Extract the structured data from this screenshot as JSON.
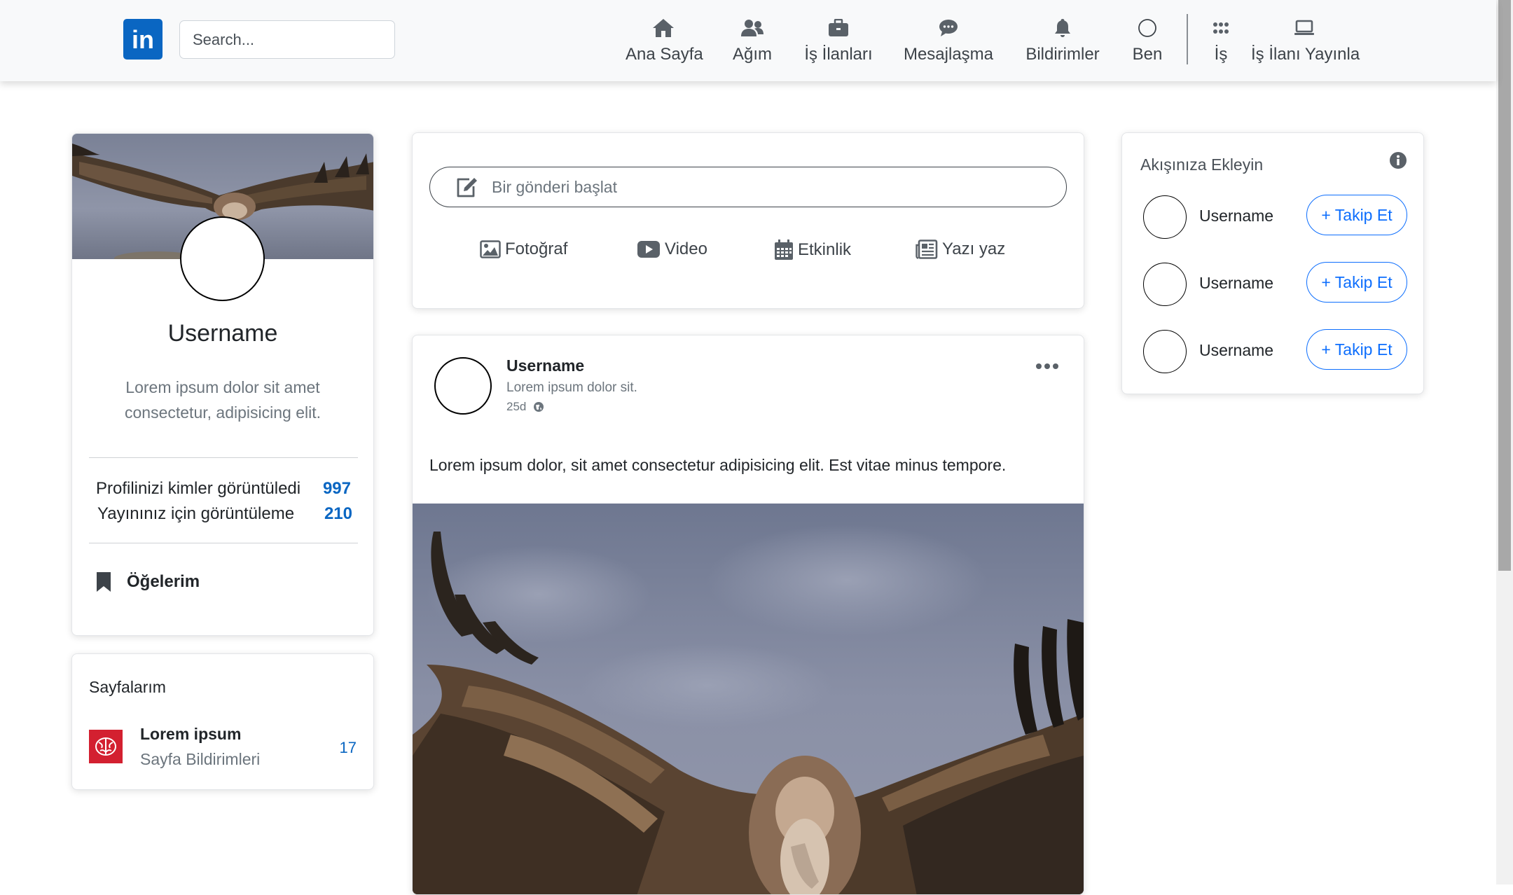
{
  "navbar": {
    "logo_text": "in",
    "search_placeholder": "Search...",
    "items": [
      {
        "label": "Ana Sayfa",
        "icon": "home-icon"
      },
      {
        "label": "Ağım",
        "icon": "people-icon"
      },
      {
        "label": "İş İlanları",
        "icon": "briefcase-icon"
      },
      {
        "label": "Mesajlaşma",
        "icon": "chat-icon"
      },
      {
        "label": "Bildirimler",
        "icon": "bell-icon"
      },
      {
        "label": "Ben",
        "icon": "circle-icon"
      },
      {
        "label": "İş",
        "icon": "grid-icon"
      },
      {
        "label": "İş İlanı Yayınla",
        "icon": "laptop-icon"
      }
    ]
  },
  "profile": {
    "name": "Username",
    "bio": "Lorem ipsum dolor sit amet consectetur, adipisicing elit.",
    "stats": [
      {
        "label": "Profilinizi kimler görüntüledi",
        "value": "997"
      },
      {
        "label": "Yayınınız için görüntüleme",
        "value": "210"
      }
    ],
    "items_label": "Öğelerim"
  },
  "pages": {
    "title": "Sayfalarım",
    "page_name": "Lorem ipsum",
    "page_sub": "Sayfa Bildirimleri",
    "count": "17"
  },
  "share": {
    "placeholder": "Bir gönderi başlat",
    "buttons": [
      "Fotoğraf",
      "Video",
      "Etkinlik",
      "Yazı yaz"
    ]
  },
  "post": {
    "user": "Username",
    "subtitle": "Lorem ipsum dolor sit.",
    "time": "25d",
    "text": "Lorem ipsum dolor, sit amet consectetur adipisicing elit. Est vitae minus tempore."
  },
  "follow": {
    "title": "Akışınıza Ekleyin",
    "users": [
      {
        "name": "Username",
        "button": "+ Takip Et"
      },
      {
        "name": "Username",
        "button": "+ Takip Et"
      },
      {
        "name": "Username",
        "button": "+ Takip Et"
      }
    ]
  },
  "colors": {
    "brand": "#0a66c2",
    "follow_blue": "#0d6efd",
    "navbar_bg": "#f8f9fa"
  }
}
